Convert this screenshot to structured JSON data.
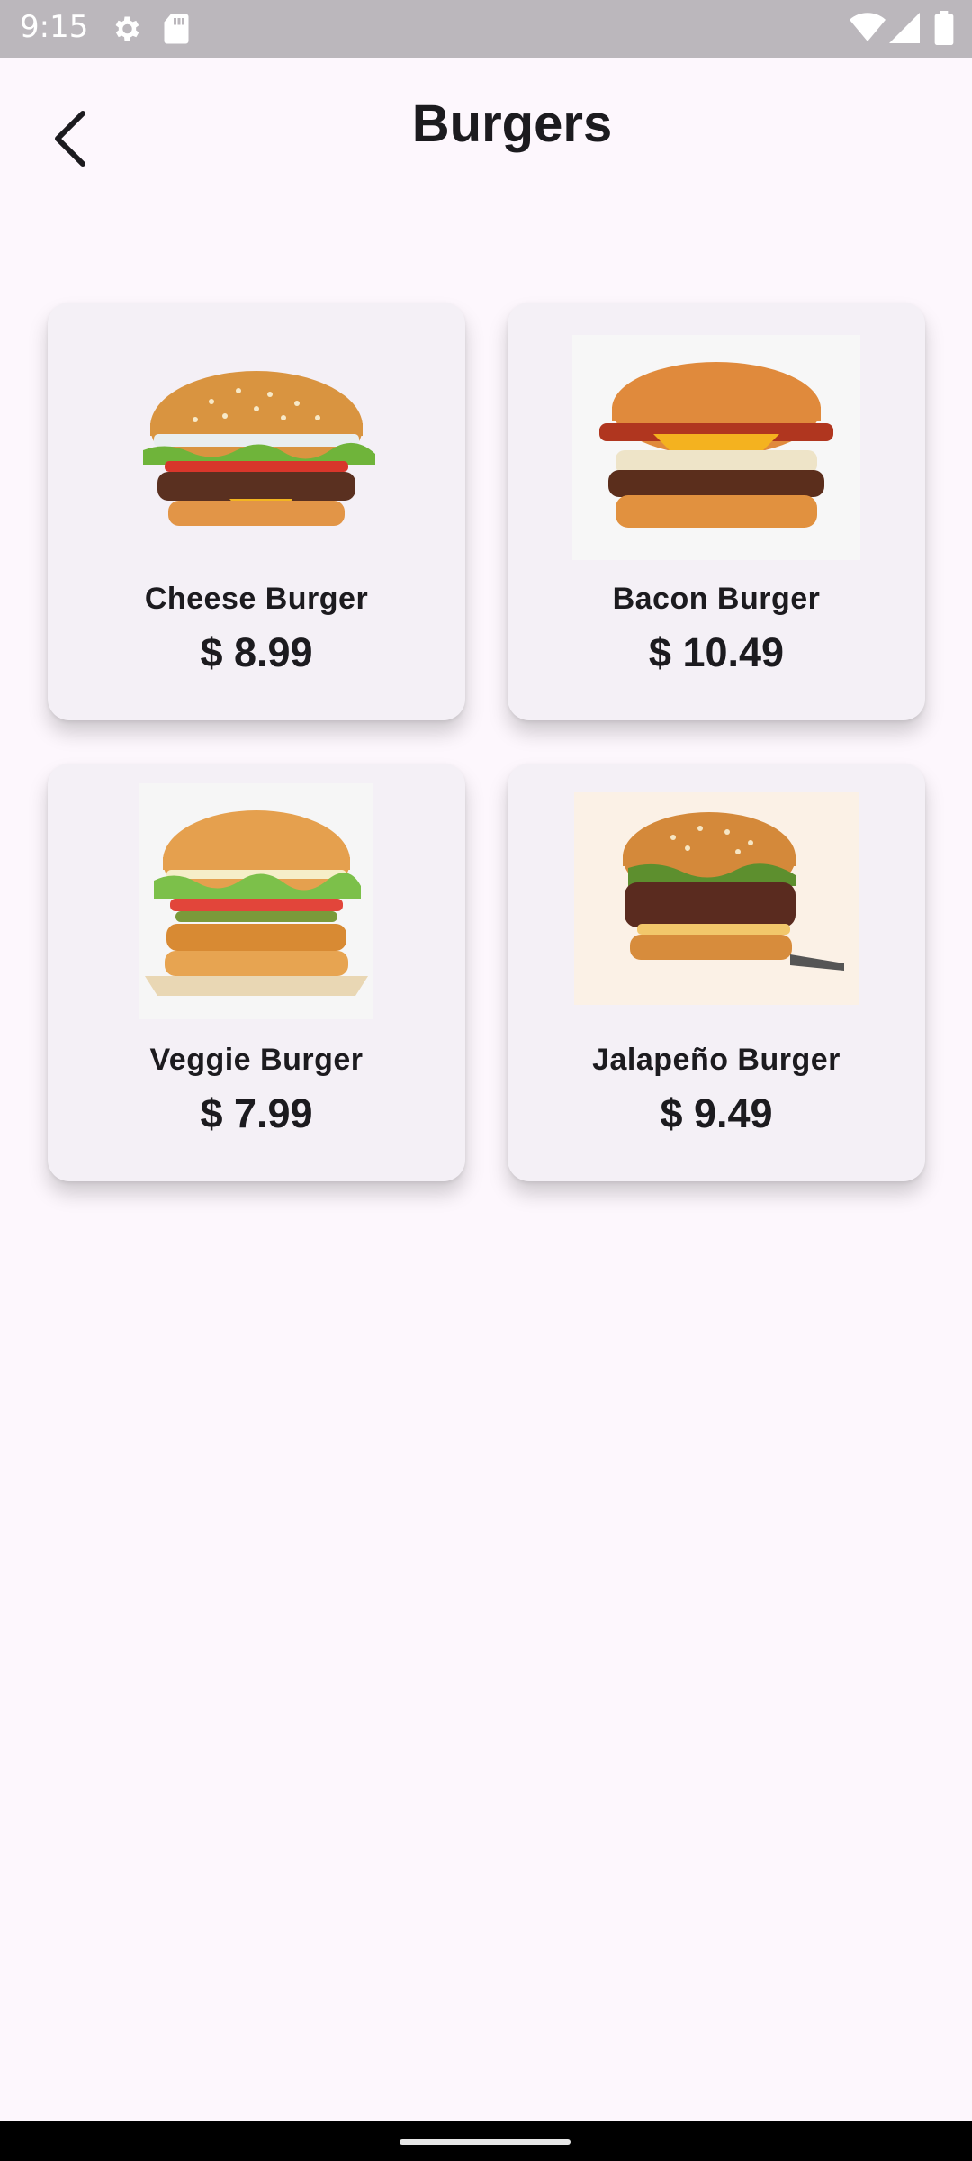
{
  "status_bar": {
    "time": "9:15",
    "icons": [
      "settings-icon",
      "sd-card-icon",
      "wifi-icon",
      "signal-icon",
      "battery-icon"
    ]
  },
  "header": {
    "title": "Burgers",
    "back_icon": "arrow-back-icon"
  },
  "products": [
    {
      "name": "Cheese Burger",
      "price": "$ 8.99"
    },
    {
      "name": "Bacon Burger",
      "price": "$ 10.49"
    },
    {
      "name": "Veggie Burger",
      "price": "$ 7.99"
    },
    {
      "name": "Jalapeño Burger",
      "price": "$ 9.49"
    }
  ],
  "colors": {
    "background": "#fdf7fd",
    "card": "#f4f0f6",
    "status_bar": "#bbb7bc",
    "text": "#1c1b1f"
  }
}
